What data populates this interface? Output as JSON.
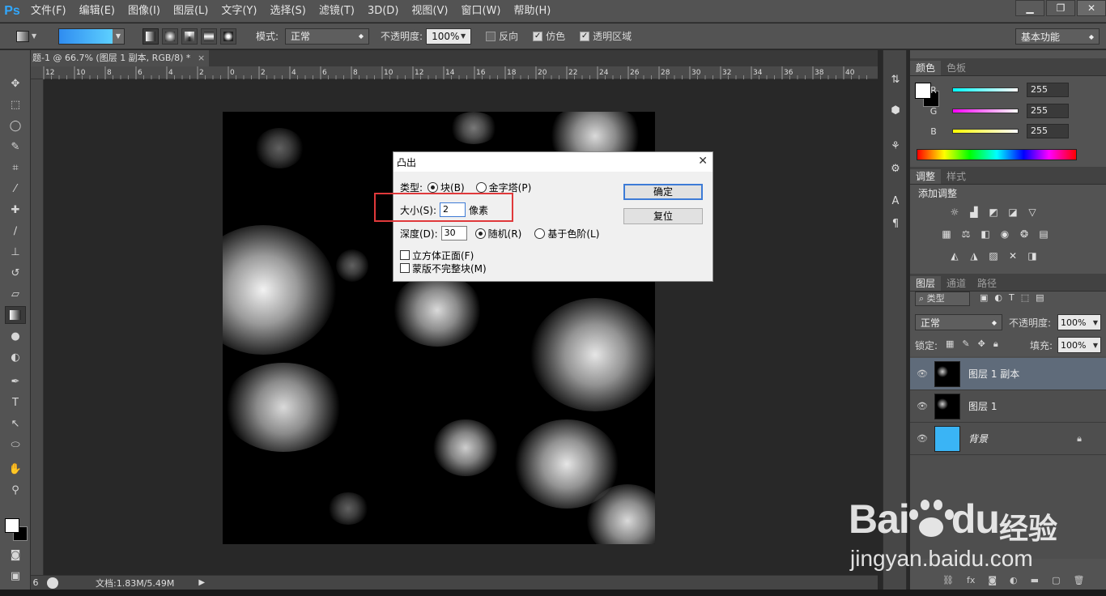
{
  "menubar": {
    "logo": "Ps",
    "items": [
      "文件(F)",
      "编辑(E)",
      "图像(I)",
      "图层(L)",
      "文字(Y)",
      "选择(S)",
      "滤镜(T)",
      "3D(D)",
      "视图(V)",
      "窗口(W)",
      "帮助(H)"
    ]
  },
  "options": {
    "mode_label": "模式:",
    "mode_value": "正常",
    "opacity_label": "不透明度:",
    "opacity_value": "100%",
    "reverse_label": "反向",
    "dither_label": "仿色",
    "transparency_label": "透明区域",
    "workspace": "基本功能",
    "gradient_colors": [
      "#2f8cf0",
      "#5dd0ff"
    ]
  },
  "document": {
    "tab_title": "题-1 @ 66.7% (图层 1 副本, RGB/8) *",
    "tab_close": "×",
    "ruler_labels": [
      "12",
      "10",
      "8",
      "6",
      "4",
      "2",
      "0",
      "2",
      "4",
      "6",
      "8",
      "10",
      "12",
      "14",
      "16",
      "18",
      "20",
      "22",
      "24",
      "26",
      "28",
      "30",
      "32",
      "34",
      "36",
      "38",
      "40"
    ],
    "status_zoom": "6",
    "status_doc": "文档:1.83M/5.49M"
  },
  "color_panel": {
    "tabs": [
      "颜色",
      "色板"
    ],
    "channels": [
      {
        "label": "R",
        "value": "255",
        "color": "#22e0e0"
      },
      {
        "label": "G",
        "value": "255",
        "color": "#e040e0"
      },
      {
        "label": "B",
        "value": "255",
        "color": "#e8e020"
      }
    ]
  },
  "adjust_panel": {
    "tabs": [
      "调整",
      "样式"
    ],
    "heading": "添加调整"
  },
  "layers_panel": {
    "tabs": [
      "图层",
      "通道",
      "路径"
    ],
    "filter": "类型",
    "blend_mode": "正常",
    "opacity_label": "不透明度:",
    "opacity_value": "100%",
    "lock_label": "锁定:",
    "fill_label": "填充:",
    "fill_value": "100%",
    "layers": [
      {
        "name": "图层 1 副本",
        "selected": true
      },
      {
        "name": "图层 1",
        "selected": false
      },
      {
        "name": "背景",
        "selected": false,
        "locked": true
      }
    ]
  },
  "dialog": {
    "title": "凸出",
    "close": "✕",
    "type_label": "类型:",
    "type_block": "块(B)",
    "type_pyramid": "金字塔(P)",
    "size_label": "大小(S):",
    "size_value": "2",
    "size_unit": "像素",
    "depth_label": "深度(D):",
    "depth_value": "30",
    "depth_random": "随机(R)",
    "depth_level": "基于色阶(L)",
    "solid_front": "立方体正面(F)",
    "mask_incomplete": "蒙版不完整块(M)",
    "ok": "确定",
    "reset": "复位"
  },
  "watermark": {
    "brand": "Bai",
    "brand_tail": "du",
    "cn": "经验",
    "url": "jingyan.baidu.com"
  }
}
